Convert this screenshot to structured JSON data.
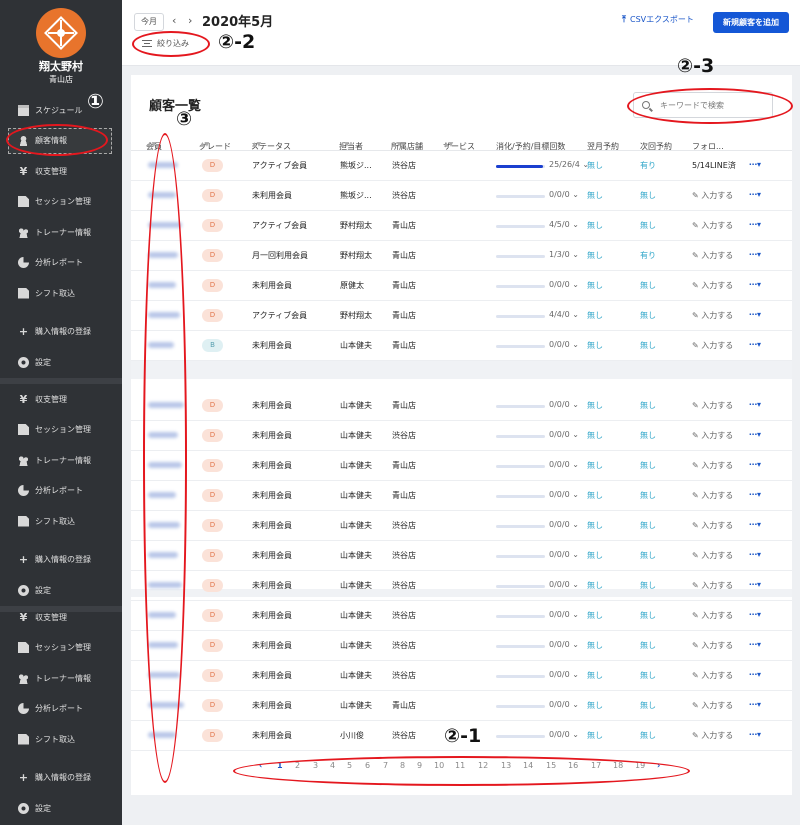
{
  "sidebar": {
    "brand_name": "翔太野村",
    "store_name": "青山店",
    "groups": [
      {
        "items": [
          {
            "label": "スケジュール",
            "icon": "calendar-icon"
          },
          {
            "label": "顧客情報",
            "icon": "user-icon",
            "active": true
          },
          {
            "label": "収支管理",
            "icon": "yen-icon"
          },
          {
            "label": "セッション管理",
            "icon": "document-icon"
          },
          {
            "label": "トレーナー情報",
            "icon": "users-icon"
          },
          {
            "label": "分析レポート",
            "icon": "pie-chart-icon"
          },
          {
            "label": "シフト取込",
            "icon": "document-icon"
          },
          {
            "label": "購入情報の登録",
            "icon": "plus-icon"
          },
          {
            "label": "設定",
            "icon": "gear-icon"
          }
        ]
      },
      {
        "items": [
          {
            "label": "収支管理",
            "icon": "yen-icon"
          },
          {
            "label": "セッション管理",
            "icon": "document-icon"
          },
          {
            "label": "トレーナー情報",
            "icon": "users-icon"
          },
          {
            "label": "分析レポート",
            "icon": "pie-chart-icon"
          },
          {
            "label": "シフト取込",
            "icon": "document-icon"
          },
          {
            "label": "購入情報の登録",
            "icon": "plus-icon"
          },
          {
            "label": "設定",
            "icon": "gear-icon"
          }
        ]
      },
      {
        "items": [
          {
            "label": "収支管理",
            "icon": "yen-icon"
          },
          {
            "label": "セッション管理",
            "icon": "document-icon"
          },
          {
            "label": "トレーナー情報",
            "icon": "users-icon"
          },
          {
            "label": "分析レポート",
            "icon": "pie-chart-icon"
          },
          {
            "label": "シフト取込",
            "icon": "document-icon"
          },
          {
            "label": "購入情報の登録",
            "icon": "plus-icon"
          },
          {
            "label": "設定",
            "icon": "gear-icon"
          }
        ]
      }
    ]
  },
  "header": {
    "today_label": "今月",
    "prev_icon": "chevron-left-icon",
    "next_icon": "chevron-right-icon",
    "month": "2020年5月",
    "filter_label": "絞り込み",
    "csv_label": "CSVエクスポート",
    "new_customer_label": "新規顧客を追加"
  },
  "main": {
    "title": "顧客一覧",
    "search_placeholder": "キーワードで検索",
    "columns": [
      "会員",
      "グレード",
      "ステータス",
      "担当者",
      "所属店舗",
      "サービス",
      "消化/予約/目標回数",
      "翌月予約",
      "次回予約",
      "フォロ..."
    ],
    "rows": [
      {
        "grade": "D",
        "status": "アクティブ会員",
        "staff": "熊坂ジ...",
        "store": "渋谷店",
        "progress": 0.96,
        "counts": "25/26/4",
        "next_month": "無し",
        "next_reserve": "有り",
        "follow": "5/14LINE済",
        "follow_set": true
      },
      {
        "grade": "D",
        "status": "未利用会員",
        "staff": "熊坂ジ...",
        "store": "渋谷店",
        "progress": 0,
        "counts": "0/0/0",
        "next_month": "無し",
        "next_reserve": "無し",
        "follow": "入力する",
        "follow_set": false
      },
      {
        "grade": "D",
        "status": "アクティブ会員",
        "staff": "野村翔太",
        "store": "青山店",
        "progress": 0,
        "counts": "4/5/0",
        "next_month": "無し",
        "next_reserve": "無し",
        "follow": "入力する",
        "follow_set": false
      },
      {
        "grade": "D",
        "status": "月一回利用会員",
        "staff": "野村翔太",
        "store": "青山店",
        "progress": 0,
        "counts": "1/3/0",
        "next_month": "無し",
        "next_reserve": "有り",
        "follow": "入力する",
        "follow_set": false
      },
      {
        "grade": "D",
        "status": "未利用会員",
        "staff": "原健太",
        "store": "青山店",
        "progress": 0,
        "counts": "0/0/0",
        "next_month": "無し",
        "next_reserve": "無し",
        "follow": "入力する",
        "follow_set": false
      },
      {
        "grade": "D",
        "status": "アクティブ会員",
        "staff": "野村翔太",
        "store": "青山店",
        "progress": 0,
        "counts": "4/4/0",
        "next_month": "無し",
        "next_reserve": "無し",
        "follow": "入力する",
        "follow_set": false
      },
      {
        "grade": "B",
        "status": "未利用会員",
        "staff": "山本健夫",
        "store": "青山店",
        "progress": 0,
        "counts": "0/0/0",
        "next_month": "無し",
        "next_reserve": "無し",
        "follow": "入力する",
        "follow_set": false
      },
      {
        "grade": "D",
        "status": "未利用会員",
        "staff": "山本健夫",
        "store": "青山店",
        "progress": 0,
        "counts": "0/0/0",
        "next_month": "無し",
        "next_reserve": "無し",
        "follow": "入力する",
        "follow_set": false
      },
      {
        "grade": "D",
        "status": "未利用会員",
        "staff": "山本健夫",
        "store": "渋谷店",
        "progress": 0,
        "counts": "0/0/0",
        "next_month": "無し",
        "next_reserve": "無し",
        "follow": "入力する",
        "follow_set": false
      },
      {
        "grade": "D",
        "status": "未利用会員",
        "staff": "山本健夫",
        "store": "青山店",
        "progress": 0,
        "counts": "0/0/0",
        "next_month": "無し",
        "next_reserve": "無し",
        "follow": "入力する",
        "follow_set": false
      },
      {
        "grade": "D",
        "status": "未利用会員",
        "staff": "山本健夫",
        "store": "青山店",
        "progress": 0,
        "counts": "0/0/0",
        "next_month": "無し",
        "next_reserve": "無し",
        "follow": "入力する",
        "follow_set": false
      },
      {
        "grade": "D",
        "status": "未利用会員",
        "staff": "山本健夫",
        "store": "渋谷店",
        "progress": 0,
        "counts": "0/0/0",
        "next_month": "無し",
        "next_reserve": "無し",
        "follow": "入力する",
        "follow_set": false
      },
      {
        "grade": "D",
        "status": "未利用会員",
        "staff": "山本健夫",
        "store": "渋谷店",
        "progress": 0,
        "counts": "0/0/0",
        "next_month": "無し",
        "next_reserve": "無し",
        "follow": "入力する",
        "follow_set": false
      },
      {
        "grade": "D",
        "status": "未利用会員",
        "staff": "山本健夫",
        "store": "渋谷店",
        "progress": 0,
        "counts": "0/0/0",
        "next_month": "無し",
        "next_reserve": "無し",
        "follow": "入力する",
        "follow_set": false
      },
      {
        "grade": "D",
        "status": "未利用会員",
        "staff": "山本健夫",
        "store": "渋谷店",
        "progress": 0,
        "counts": "0/0/0",
        "next_month": "無し",
        "next_reserve": "無し",
        "follow": "入力する",
        "follow_set": false
      },
      {
        "grade": "D",
        "status": "未利用会員",
        "staff": "山本健夫",
        "store": "渋谷店",
        "progress": 0,
        "counts": "0/0/0",
        "next_month": "無し",
        "next_reserve": "無し",
        "follow": "入力する",
        "follow_set": false
      },
      {
        "grade": "D",
        "status": "未利用会員",
        "staff": "山本健夫",
        "store": "渋谷店",
        "progress": 0,
        "counts": "0/0/0",
        "next_month": "無し",
        "next_reserve": "無し",
        "follow": "入力する",
        "follow_set": false
      },
      {
        "grade": "D",
        "status": "未利用会員",
        "staff": "山本健夫",
        "store": "青山店",
        "progress": 0,
        "counts": "0/0/0",
        "next_month": "無し",
        "next_reserve": "無し",
        "follow": "入力する",
        "follow_set": false
      },
      {
        "grade": "D",
        "status": "未利用会員",
        "staff": "小川俊",
        "store": "渋谷店",
        "progress": 0,
        "counts": "0/0/0",
        "next_month": "無し",
        "next_reserve": "無し",
        "follow": "入力する",
        "follow_set": false
      }
    ],
    "pagination": {
      "prev": "‹",
      "next": "›",
      "current": "1",
      "pages": [
        "1",
        "2",
        "3",
        "4",
        "5",
        "6",
        "7",
        "8",
        "9",
        "10",
        "11",
        "12",
        "13",
        "14",
        "15",
        "16",
        "17",
        "18",
        "19"
      ]
    }
  },
  "annotations": {
    "mark_1": "①",
    "mark_2_1": "②-1",
    "mark_2_2": "②-2",
    "mark_2_3": "②-3",
    "mark_3": "③"
  },
  "colors": {
    "sidebar_bg": "#2f3236",
    "primary": "#1457d6",
    "link_cyan": "#2fa6c9",
    "grade_d_bg": "#fbe2d8",
    "grade_d_text": "#e0754c",
    "annotation_red": "#e4171e"
  }
}
